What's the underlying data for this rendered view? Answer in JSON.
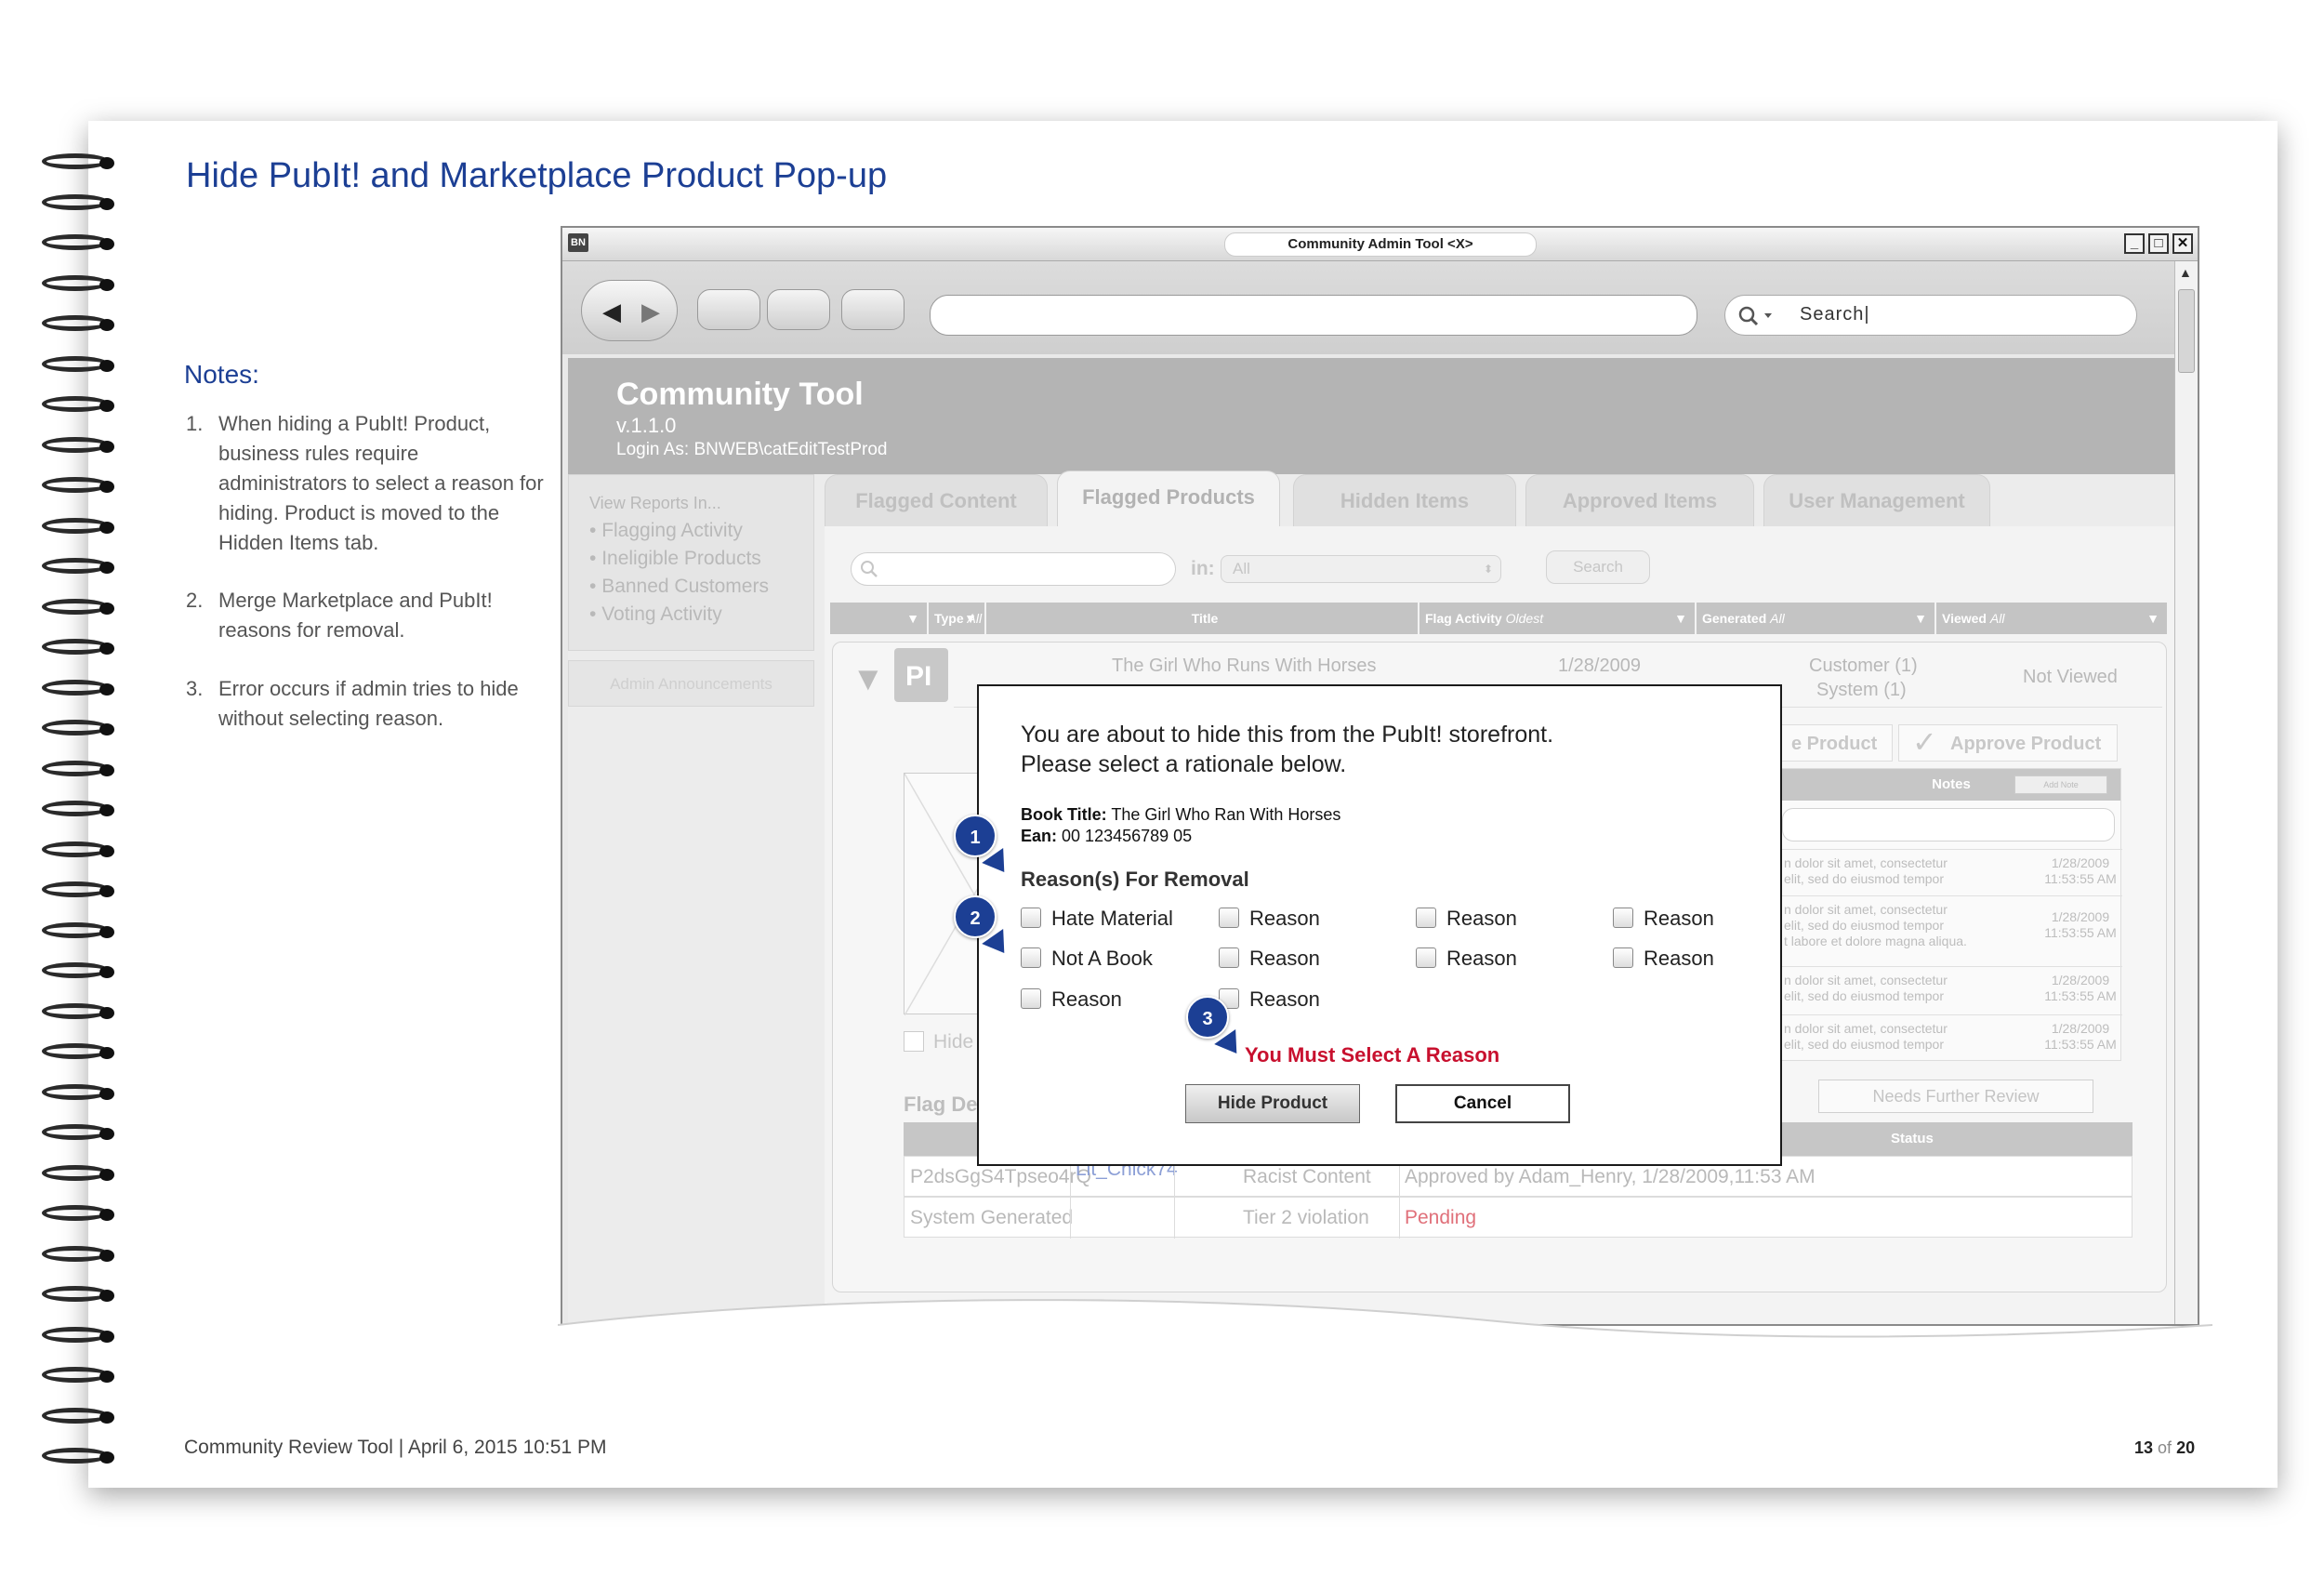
{
  "document": {
    "title": "Hide PubIt! and Marketplace Product Pop-up",
    "notes_heading": "Notes:",
    "notes": [
      {
        "num": "1.",
        "text": "When hiding a PubIt! Product, business rules require administrators to select a reason for hiding. Product is moved to the Hidden Items tab."
      },
      {
        "num": "2.",
        "text": "Merge Marketplace and PubIt! reasons for removal."
      },
      {
        "num": "3.",
        "text": "Error occurs if admin tries to hide without selecting reason."
      }
    ],
    "footer_left": "Community Review Tool | April 6, 2015 10:51 PM",
    "page_num": "13",
    "page_of": "of",
    "page_total": "20"
  },
  "window": {
    "title": "Community Admin Tool <X>",
    "app_badge": "BN",
    "search_text": "Search|",
    "btn_min": "_",
    "btn_max": "□",
    "btn_close": "✕"
  },
  "app": {
    "name": "Community Tool",
    "version": "v.1.1.0",
    "login": "Login As: BNWEB\\catEditTestProd",
    "sidebar": {
      "label": "View Reports In...",
      "items": [
        "Flagging Activity",
        "Ineligible Products",
        "Banned Customers",
        "Voting Activity"
      ],
      "announcements": "Admin Announcements"
    },
    "tabs": [
      "Flagged Content",
      "Flagged Products",
      "Hidden Items",
      "Approved Items",
      "User Management"
    ],
    "filter": {
      "in_label": "in:",
      "select_value": "All",
      "search_btn": "Search"
    },
    "columns": [
      {
        "label": "",
        "italic": ""
      },
      {
        "label": "Type",
        "italic": "All"
      },
      {
        "label": "Title",
        "italic": ""
      },
      {
        "label": "Flag Activity",
        "italic": "Oldest"
      },
      {
        "label": "Generated",
        "italic": "All"
      },
      {
        "label": "Viewed",
        "italic": "All"
      }
    ],
    "row": {
      "type_badge": "PI",
      "title": "The Girl Who Runs With Horses",
      "date": "1/28/2009",
      "generated_1": "Customer (1)",
      "generated_2": "System (1)",
      "viewed": "Not Viewed"
    },
    "hide_product_partial": "e Product",
    "approve_product": "Approve Product",
    "notes_panel": {
      "header": "Notes",
      "add_note": "Add Note",
      "rows": [
        {
          "l1": "n dolor sit amet, consectetur",
          "l2": "elit, sed do eiusmod tempor",
          "l3": "",
          "d1": "1/28/2009",
          "d2": "11:53:55 AM"
        },
        {
          "l1": "n dolor sit amet, consectetur",
          "l2": "elit, sed do eiusmod tempor",
          "l3": "t labore et dolore magna aliqua.",
          "d1": "1/28/2009",
          "d2": "11:53:55 AM"
        },
        {
          "l1": "n dolor sit amet, consectetur",
          "l2": "elit, sed do eiusmod tempor",
          "l3": "",
          "d1": "1/28/2009",
          "d2": "11:53:55 AM"
        },
        {
          "l1": "n dolor sit amet, consectetur",
          "l2": "elit, sed do eiusmod tempor",
          "l3": "",
          "d1": "1/28/2009",
          "d2": "11:53:55 AM"
        }
      ]
    },
    "needs_review": "Needs Further Review",
    "hide_checkbox_label": "Hide",
    "flag_details_partial": "Flag De",
    "details": {
      "status_header": "Status",
      "rows": [
        {
          "id": "P2dsGgS4Tpseo4rQ",
          "user": "Lit_Chick74",
          "reason": "Racist Content",
          "status": "Approved by Adam_Henry, 1/28/2009,11:53 AM"
        },
        {
          "id": "System Generated",
          "user": "",
          "reason": "Tier 2 violation",
          "status": "Pending"
        }
      ]
    }
  },
  "modal": {
    "message_line1": "You are about to hide this from the PubIt! storefront.",
    "message_line2": "Please select a rationale below.",
    "book_title_label": "Book Title:",
    "book_title": "The Girl Who Ran With Horses",
    "ean_label": "Ean:",
    "ean": "00 123456789 05",
    "reasons_header": "Reason(s) For Removal",
    "reasons": [
      "Hate Material",
      "Reason",
      "Reason",
      "Reason",
      "Not A Book",
      "Reason",
      "Reason",
      "Reason",
      "Reason",
      "Reason"
    ],
    "error": "You Must Select A Reason",
    "hide_button": "Hide Product",
    "cancel_button": "Cancel"
  },
  "callouts": [
    "1",
    "2",
    "3"
  ],
  "colors": {
    "brand_blue": "#1c3f94",
    "error_red": "#c8102e",
    "pending_red": "#e0707a",
    "link_blue": "#8c9fd6"
  }
}
